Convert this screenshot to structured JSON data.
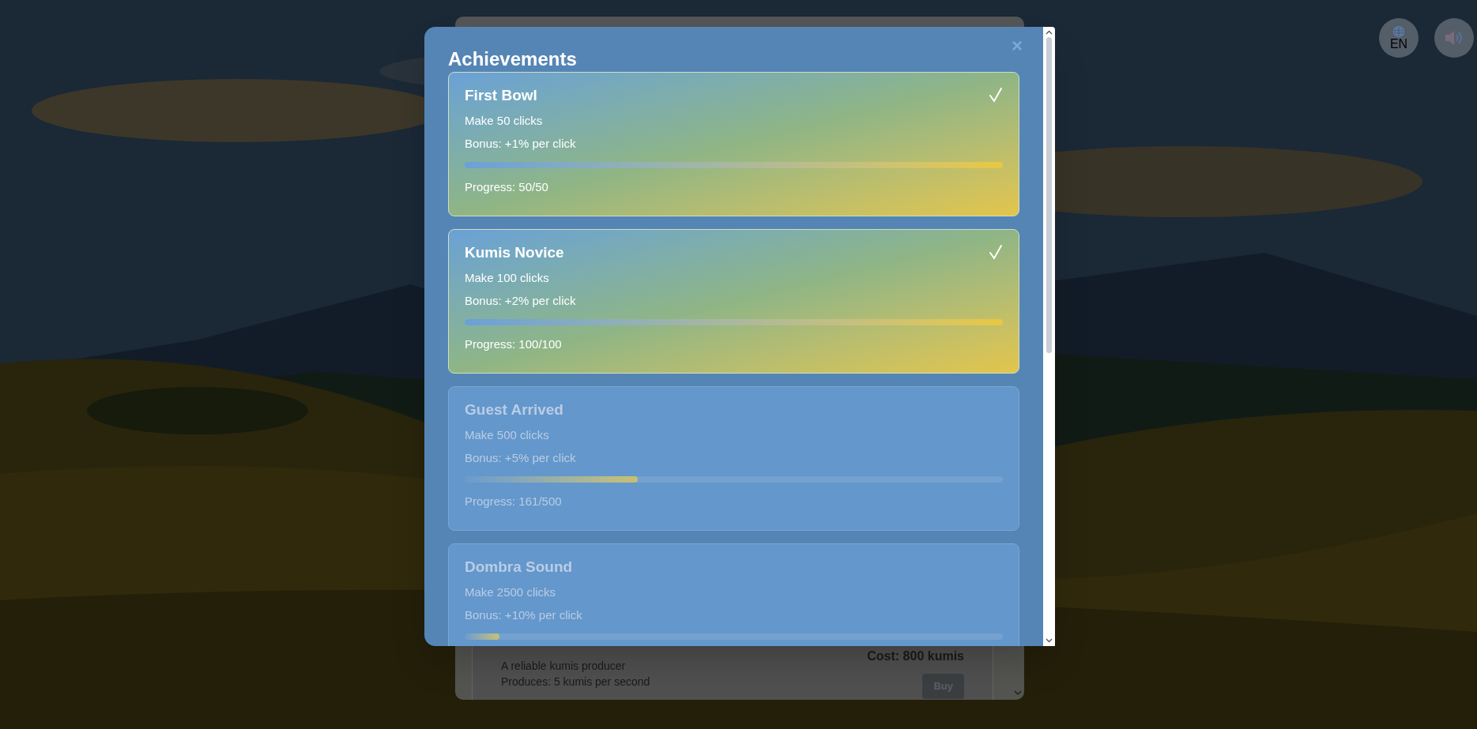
{
  "top_controls": {
    "language": "EN",
    "sound_on": false
  },
  "shop": {
    "item": {
      "description": "A reliable kumis producer",
      "produces": "Produces: 5 kumis per second",
      "cost": "Cost: 800 kumis",
      "button": "Buy",
      "disabled": true
    }
  },
  "modal": {
    "title": "Achievements",
    "close": "×",
    "achievements": [
      {
        "name": "First Bowl",
        "requirement": "Make 50 clicks",
        "bonus": "Bonus: +1% per click",
        "level": 1,
        "progress": "Progress: 50/50",
        "completed": true
      },
      {
        "name": "Kumis Novice",
        "requirement": "Make 100 clicks",
        "bonus": "Bonus: +2% per click",
        "level": 1,
        "progress": "Progress: 100/100",
        "completed": true
      },
      {
        "name": "Guest Arrived",
        "requirement": "Make 500 clicks",
        "bonus": "Bonus: +5% per click",
        "level": 0.322,
        "progress": "Progress: 161/500",
        "completed": false
      },
      {
        "name": "Dombra Sound",
        "requirement": "Make 2500 clicks",
        "bonus": "Bonus: +10% per click",
        "level": 0.0644,
        "completed": false
      }
    ]
  }
}
